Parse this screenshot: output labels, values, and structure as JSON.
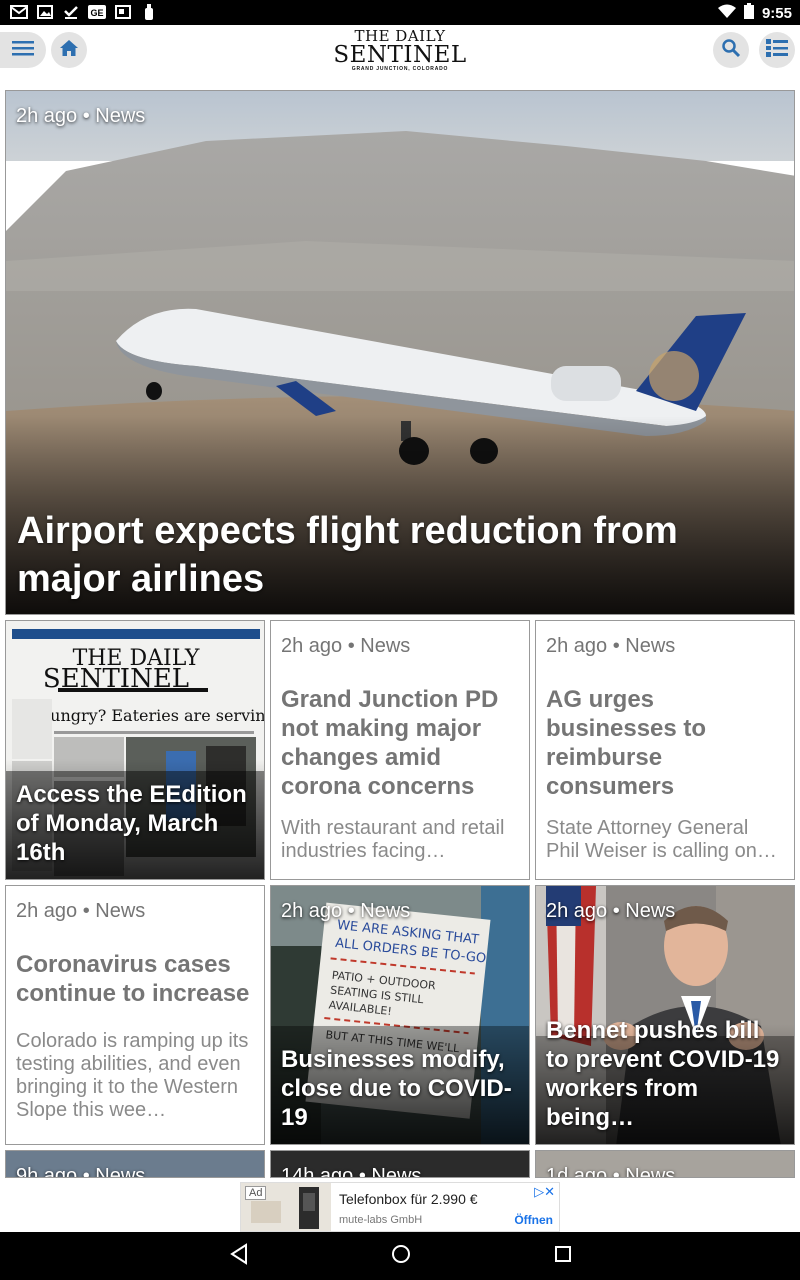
{
  "status_bar": {
    "time": "9:55",
    "icons": [
      "gmail-icon",
      "image-icon",
      "download-done-icon",
      "ge-icon",
      "news-icon",
      "bottle-icon"
    ],
    "right_icons": [
      "wifi-icon",
      "battery-icon"
    ]
  },
  "app_bar": {
    "masthead_top": "THE DAILY",
    "masthead_name": "SENTINEL",
    "masthead_location": "GRAND JUNCTION, COLORADO",
    "icons": {
      "menu": "hamburger-menu-icon",
      "home": "home-icon",
      "search": "search-icon",
      "sections": "list-icon"
    }
  },
  "hero": {
    "meta": "2h ago • News",
    "headline": "Airport expects flight reduction from major airlines"
  },
  "cards": [
    {
      "type": "image",
      "meta": "",
      "title": "Access the EEdition of Monday, March 16th"
    },
    {
      "type": "text",
      "meta": "2h ago • News",
      "title": "Grand Junction PD not making major changes amid corona concerns",
      "desc": "With restaurant and retail industries facing…"
    },
    {
      "type": "text",
      "meta": "2h ago • News",
      "title": "AG urges businesses to reimburse consumers",
      "desc": "State Attorney General Phil Weiser is calling on…"
    },
    {
      "type": "text",
      "meta": "2h ago • News",
      "title": "Coronavirus cases continue to increase",
      "desc": "Colorado is ramping up its testing abilities, and even bringing it to the Western Slope this wee…"
    },
    {
      "type": "image",
      "meta": "2h ago • News",
      "title": "Businesses modify, close due to COVID-19"
    },
    {
      "type": "image",
      "meta": "2h ago • News",
      "title": "Bennet pushes bill to prevent COVID-19 workers from being…"
    }
  ],
  "peek_cards": [
    {
      "meta": "9h ago • News"
    },
    {
      "meta": "14h ago • News"
    },
    {
      "meta": "1d ago • News"
    }
  ],
  "ad": {
    "label": "Ad",
    "title": "Telefonbox für 2.990 €",
    "advertiser": "mute-labs GmbH",
    "cta": "Öffnen"
  },
  "nav_bar": {
    "icons": [
      "back-icon",
      "home-circle-icon",
      "recents-icon"
    ]
  }
}
